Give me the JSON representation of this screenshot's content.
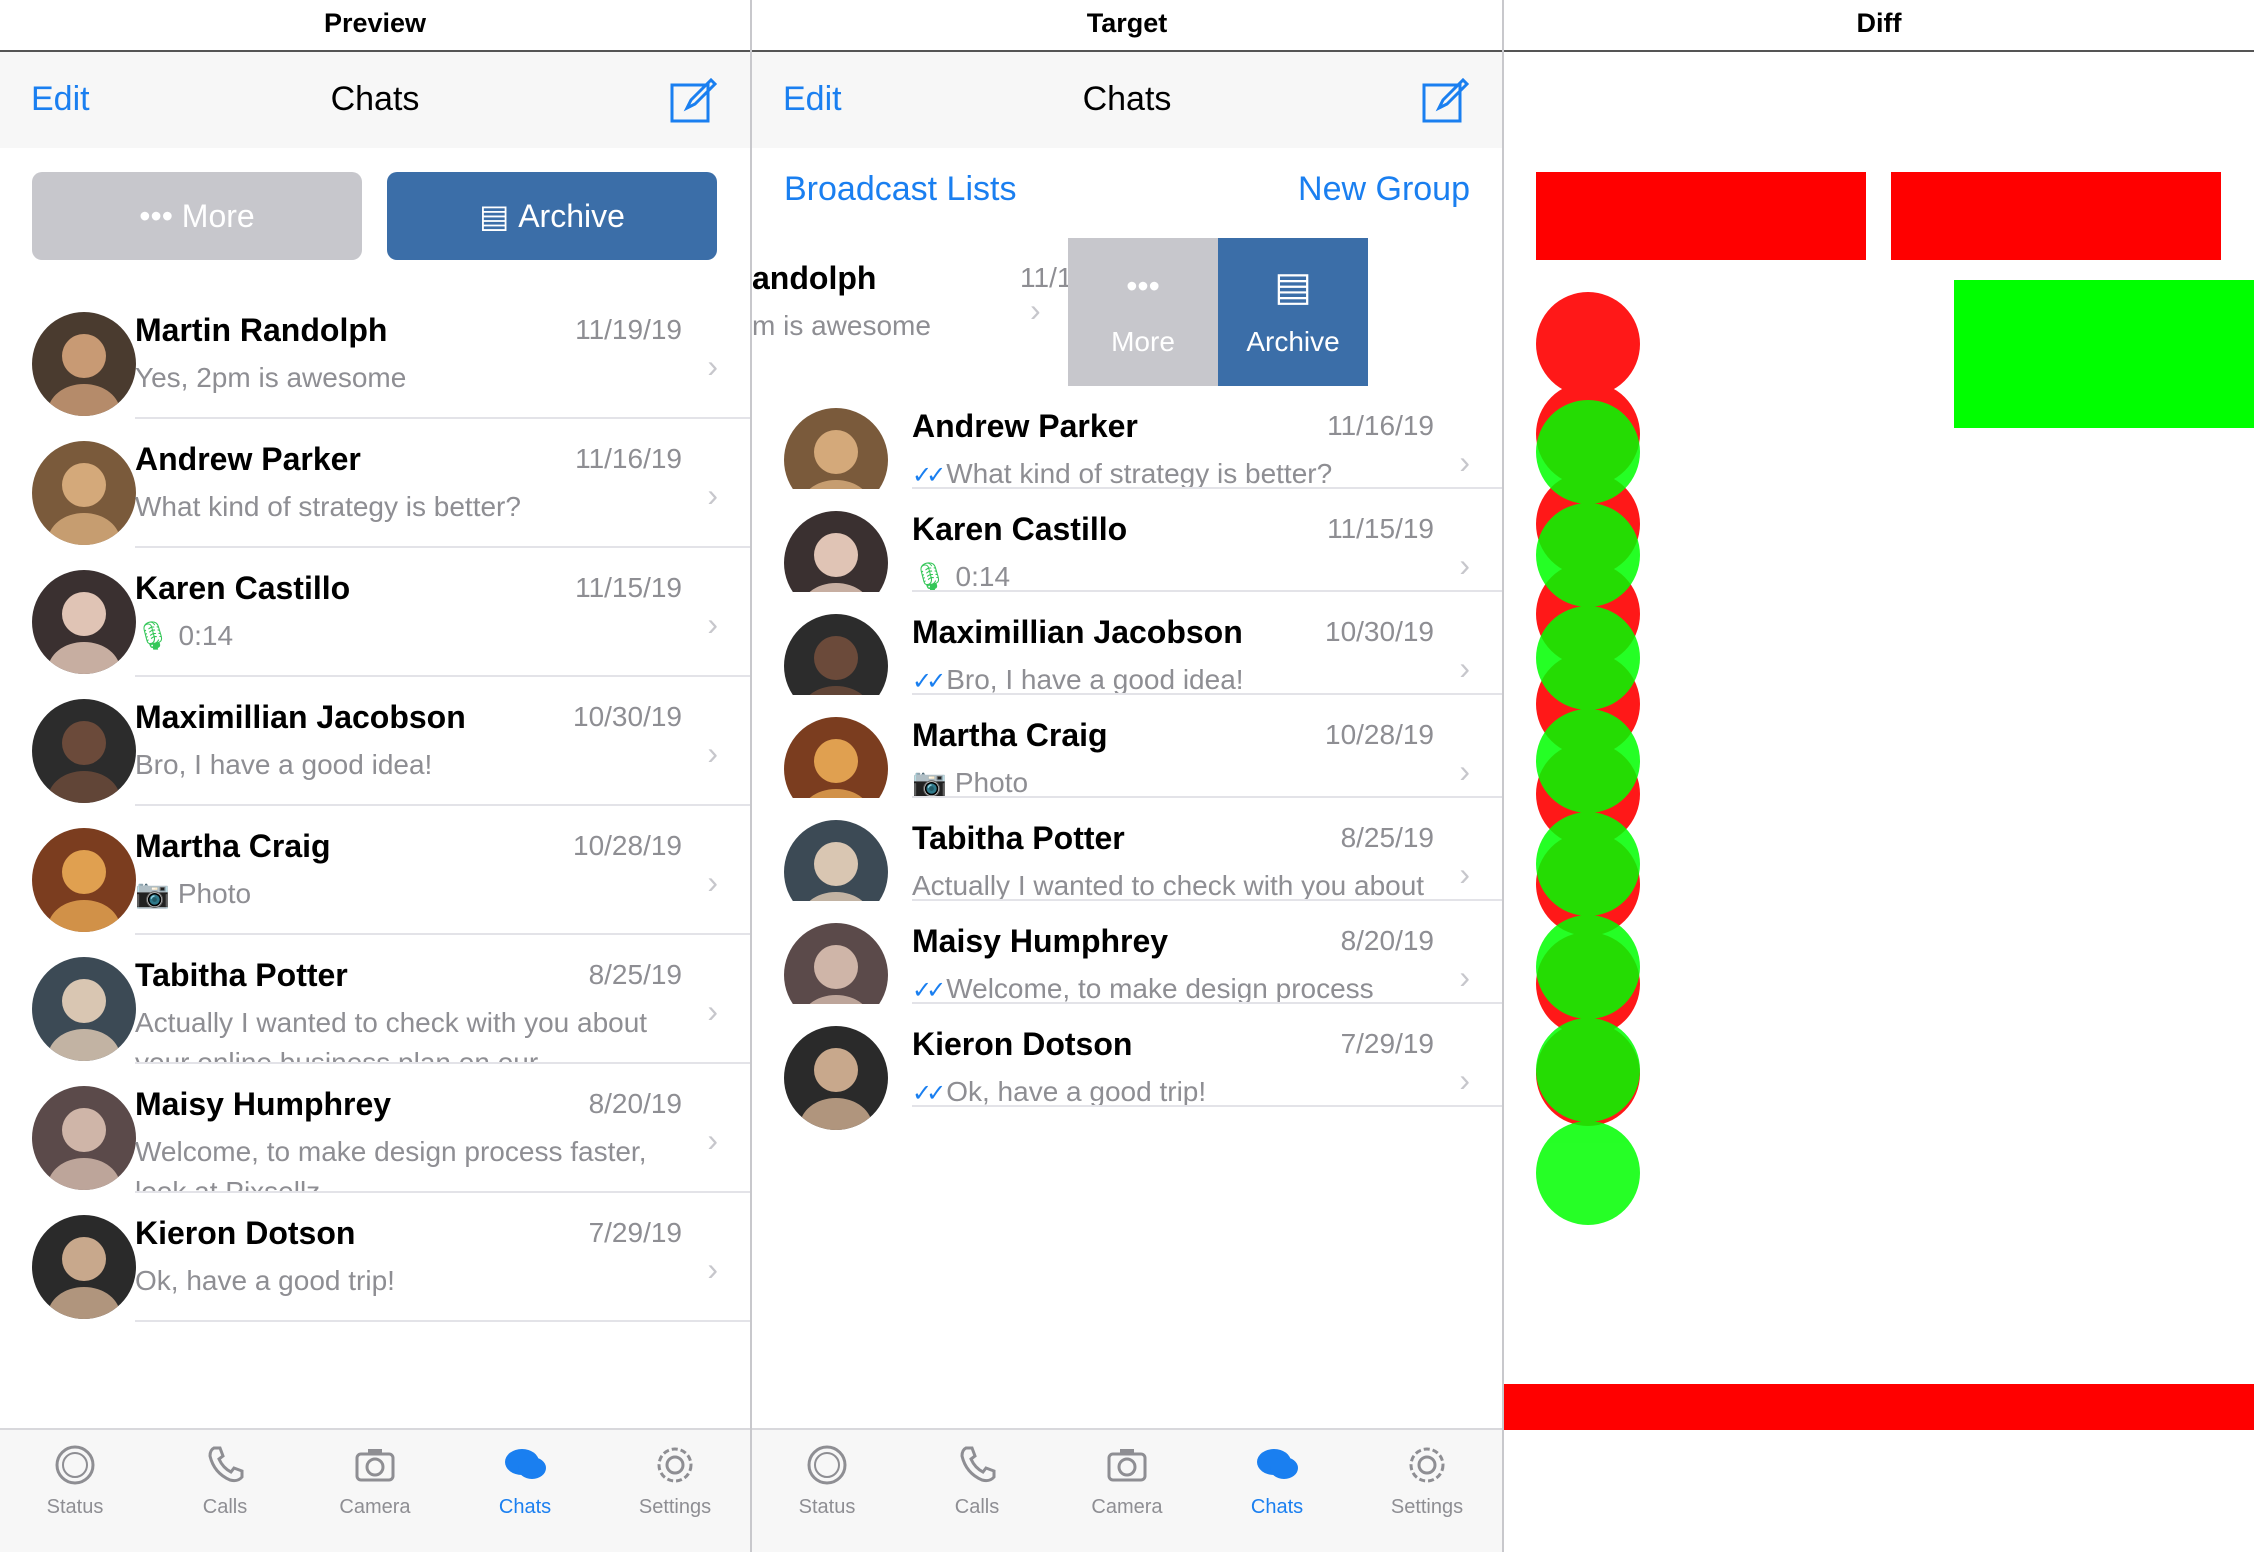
{
  "panels": {
    "preview": "Preview",
    "target": "Target",
    "diff": "Diff"
  },
  "nav": {
    "edit": "Edit",
    "title": "Chats"
  },
  "subbar": {
    "broadcast": "Broadcast Lists",
    "new_group": "New Group"
  },
  "actions": {
    "more": "More",
    "archive": "Archive"
  },
  "colors": {
    "accent": "#1a7ff0",
    "archive": "#3b6ea8",
    "more": "#c7c7cc"
  },
  "chats": [
    {
      "name": "Martin Randolph",
      "date": "11/19/19",
      "message": "Yes, 2pm is awesome",
      "ticks": false,
      "icon": ""
    },
    {
      "name": "Andrew Parker",
      "date": "11/16/19",
      "message": "What kind of strategy is better?",
      "ticks": true,
      "icon": ""
    },
    {
      "name": "Karen Castillo",
      "date": "11/15/19",
      "message": "0:14",
      "ticks": false,
      "icon": "mic-icon"
    },
    {
      "name": "Maximillian Jacobson",
      "date": "10/30/19",
      "message": "Bro, I have a good idea!",
      "ticks": true,
      "icon": ""
    },
    {
      "name": "Martha Craig",
      "date": "10/28/19",
      "message": "Photo",
      "ticks": false,
      "icon": "camera-icon"
    },
    {
      "name": "Tabitha Potter",
      "date": "8/25/19",
      "message": "Actually I wanted to check with you about your online business plan on our...",
      "ticks": false,
      "icon": ""
    },
    {
      "name": "Maisy Humphrey",
      "date": "8/20/19",
      "message": "Welcome, to make design process faster, look at Pixsellz",
      "ticks": true,
      "icon": ""
    },
    {
      "name": "Kieron Dotson",
      "date": "7/29/19",
      "message": "Ok, have a good trip!",
      "ticks": true,
      "icon": ""
    }
  ],
  "swipe_row": {
    "name_fragment": "andolph",
    "date": "11/19/19",
    "message_fragment": "m is awesome"
  },
  "tabs": [
    {
      "label": "Status",
      "icon": "status-icon",
      "active": false
    },
    {
      "label": "Calls",
      "icon": "phone-icon",
      "active": false
    },
    {
      "label": "Camera",
      "icon": "camera-icon",
      "active": false
    },
    {
      "label": "Chats",
      "icon": "chats-icon",
      "active": true
    },
    {
      "label": "Settings",
      "icon": "gear-icon",
      "active": false
    }
  ]
}
